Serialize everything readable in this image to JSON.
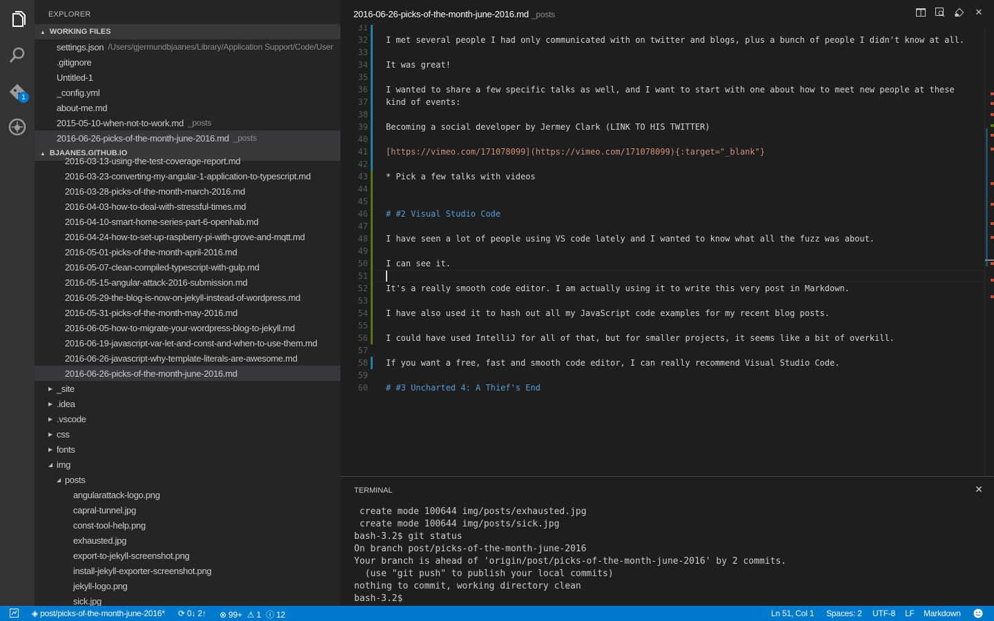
{
  "activity_bar": {
    "items": [
      "explorer-icon",
      "search-icon",
      "git-icon",
      "debug-icon"
    ],
    "git_badge": "1"
  },
  "sidebar": {
    "title": "EXPLORER",
    "working_files": {
      "header": "WORKING FILES",
      "items": [
        {
          "name": "settings.json",
          "path": "/Users/gjermundbjaanes/Library/Application Support/Code/User"
        },
        {
          "name": ".gitignore",
          "path": ""
        },
        {
          "name": "Untitled-1",
          "path": ""
        },
        {
          "name": "_config.yml",
          "path": ""
        },
        {
          "name": "about-me.md",
          "path": ""
        },
        {
          "name": "2015-05-10-when-not-to-work.md",
          "path": "_posts"
        },
        {
          "name": "2016-06-26-picks-of-the-month-june-2016.md",
          "path": "_posts"
        }
      ]
    },
    "project": {
      "header": "BJAANES.GITHUB.IO",
      "posts": [
        "2016-03-13-using-the-test-coverage-report.md",
        "2016-03-23-converting-my-angular-1-application-to-typescript.md",
        "2016-03-28-picks-of-the-month-march-2016.md",
        "2016-04-03-how-to-deal-with-stressful-times.md",
        "2016-04-10-smart-home-series-part-6-openhab.md",
        "2016-04-24-how-to-set-up-raspberry-pi-with-grove-and-mqtt.md",
        "2016-05-01-picks-of-the-month-april-2016.md",
        "2016-05-07-clean-compiled-typescript-with-gulp.md",
        "2016-05-15-angular-attack-2016-submission.md",
        "2016-05-29-the-blog-is-now-on-jekyll-instead-of-wordpress.md",
        "2016-05-31-picks-of-the-month-may-2016.md",
        "2016-06-05-how-to-migrate-your-wordpress-blog-to-jekyll.md",
        "2016-06-19-javascript-var-let-and-const-and-when-to-use-them.md",
        "2016-06-26-javascript-why-template-literals-are-awesome.md",
        "2016-06-26-picks-of-the-month-june-2016.md"
      ],
      "folders": [
        "_site",
        ".idea",
        ".vscode",
        "css",
        "fonts",
        "img"
      ],
      "subfolder": "posts",
      "images": [
        "angularattack-logo.png",
        "capral-tunnel.jpg",
        "const-tool-help.png",
        "exhausted.jpg",
        "export-to-jekyll-screenshot.png",
        "install-jekyll-exporter-screenshot.png",
        "jekyll-logo.png",
        "sick.jpg"
      ]
    }
  },
  "editor": {
    "tab": {
      "name": "2016-06-26-picks-of-the-month-june-2016.md",
      "path": "_posts"
    },
    "lines": [
      {
        "n": "31",
        "t": ""
      },
      {
        "n": "32",
        "t": "I met several people I had only communicated with on twitter and blogs, plus a bunch of people I didn't know at all."
      },
      {
        "n": "33",
        "t": ""
      },
      {
        "n": "34",
        "t": "It was great!"
      },
      {
        "n": "35",
        "t": ""
      },
      {
        "n": "36",
        "t": "I wanted to share a few specific talks as well, and I want to start with one about how to meet new people at these"
      },
      {
        "n": "37",
        "t": "kind of events:"
      },
      {
        "n": "38",
        "t": ""
      },
      {
        "n": "39",
        "t": "Becoming a social developer by Jermey Clark (LINK TO HIS TWITTER)"
      },
      {
        "n": "40",
        "t": ""
      },
      {
        "n": "41",
        "t": "[https://vimeo.com/171078099](https://vimeo.com/171078099){:target=\"_blank\"}"
      },
      {
        "n": "42",
        "t": ""
      },
      {
        "n": "43",
        "t": "* Pick a few talks with videos"
      },
      {
        "n": "44",
        "t": ""
      },
      {
        "n": "45",
        "t": ""
      },
      {
        "n": "46",
        "t": "# #2 Visual Studio Code"
      },
      {
        "n": "47",
        "t": ""
      },
      {
        "n": "48",
        "t": "I have seen a lot of people using VS code lately and I wanted to know what all the fuzz was about."
      },
      {
        "n": "49",
        "t": ""
      },
      {
        "n": "50",
        "t": "I can see it."
      },
      {
        "n": "51",
        "t": ""
      },
      {
        "n": "52",
        "t": "It's a really smooth code editor. I am actually using it to write this very post in Markdown."
      },
      {
        "n": "53",
        "t": ""
      },
      {
        "n": "54",
        "t": "I have also used it to hash out all my JavaScript code examples for my recent blog posts."
      },
      {
        "n": "55",
        "t": ""
      },
      {
        "n": "56",
        "t": "I could have used IntelliJ for all of that, but for smaller projects, it seems like a bit of overkill."
      },
      {
        "n": "57",
        "t": ""
      },
      {
        "n": "58",
        "t": "If you want a free, fast and smooth code editor, I can really recommend Visual Studio Code."
      },
      {
        "n": "59",
        "t": ""
      },
      {
        "n": "60",
        "t": "# #3 Uncharted 4: A Thief's End"
      }
    ]
  },
  "terminal": {
    "title": "TERMINAL",
    "lines": [
      " create mode 100644 img/posts/exhausted.jpg",
      " create mode 100644 img/posts/sick.jpg",
      "bash-3.2$ git status",
      "On branch post/picks-of-the-month-june-2016",
      "Your branch is ahead of 'origin/post/picks-of-the-month-june-2016' by 2 commits.",
      "  (use \"git push\" to publish your local commits)",
      "nothing to commit, working directory clean",
      "bash-3.2$"
    ]
  },
  "status_bar": {
    "branch": "post/picks-of-the-month-june-2016*",
    "sync": "0↓ 2↑",
    "errors": "99+",
    "warnings": "1",
    "info": "12",
    "position": "Ln 51, Col 1",
    "spaces": "Spaces: 2",
    "encoding": "UTF-8",
    "eol": "LF",
    "language": "Markdown"
  },
  "colors": {
    "accent": "#007acc",
    "heading": "#569cd6",
    "link_target": "#ce9178"
  }
}
